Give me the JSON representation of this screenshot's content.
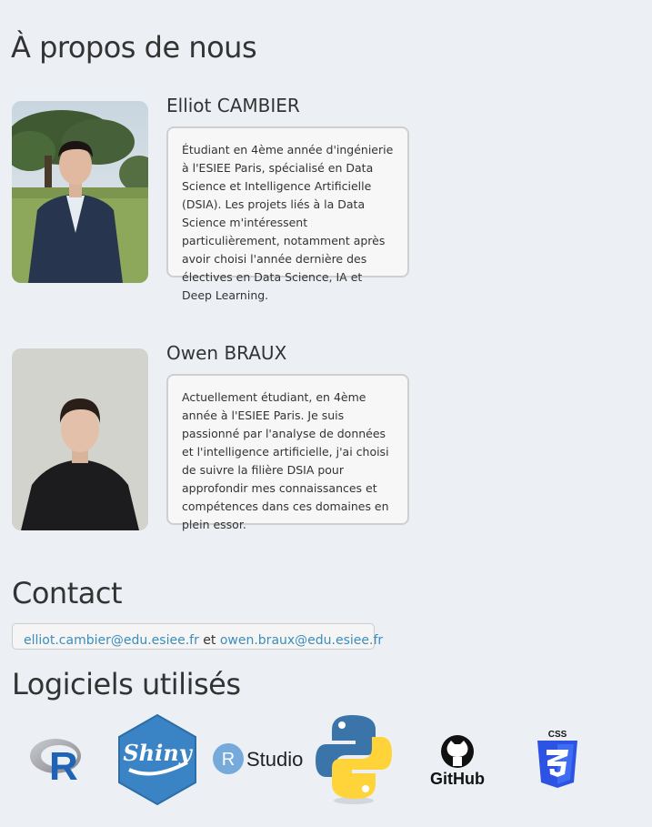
{
  "page_title": "À propos de nous",
  "members": [
    {
      "name": "Elliot CAMBIER",
      "bio": "Étudiant en 4ème année d'ingénierie à l'ESIEE Paris, spécialisé en Data Science et Intelligence Artificielle (DSIA). Les projets liés à la Data Science m'intéressent particulièrement, notamment après avoir choisi l'année dernière des électives en Data Science, IA et Deep Learning."
    },
    {
      "name": "Owen BRAUX",
      "bio": "Actuellement étudiant, en 4ème année à l'ESIEE Paris. Je suis passionné par l'analyse de données et l'intelligence artificielle, j'ai choisi de suivre la filière DSIA pour approfondir mes connaissances et compétences dans ces domaines en plein essor."
    }
  ],
  "contact": {
    "title": "Contact",
    "email1": "elliot.cambier@edu.esiee.fr",
    "separator": " et ",
    "email2": "owen.braux@edu.esiee.fr"
  },
  "software": {
    "title": "Logiciels utilisés",
    "logos": {
      "r": "R",
      "shiny": "Shiny",
      "rstudio_r": "R",
      "rstudio_text": "Studio",
      "github": "GitHub",
      "css": "CSS"
    }
  },
  "colors": {
    "background": "#ecf0f5",
    "link": "#3c8dbc",
    "shiny_blue": "#3a83c4",
    "python_blue": "#3b74a8",
    "python_yellow": "#ffd43b",
    "css_blue": "#2d53e5"
  }
}
